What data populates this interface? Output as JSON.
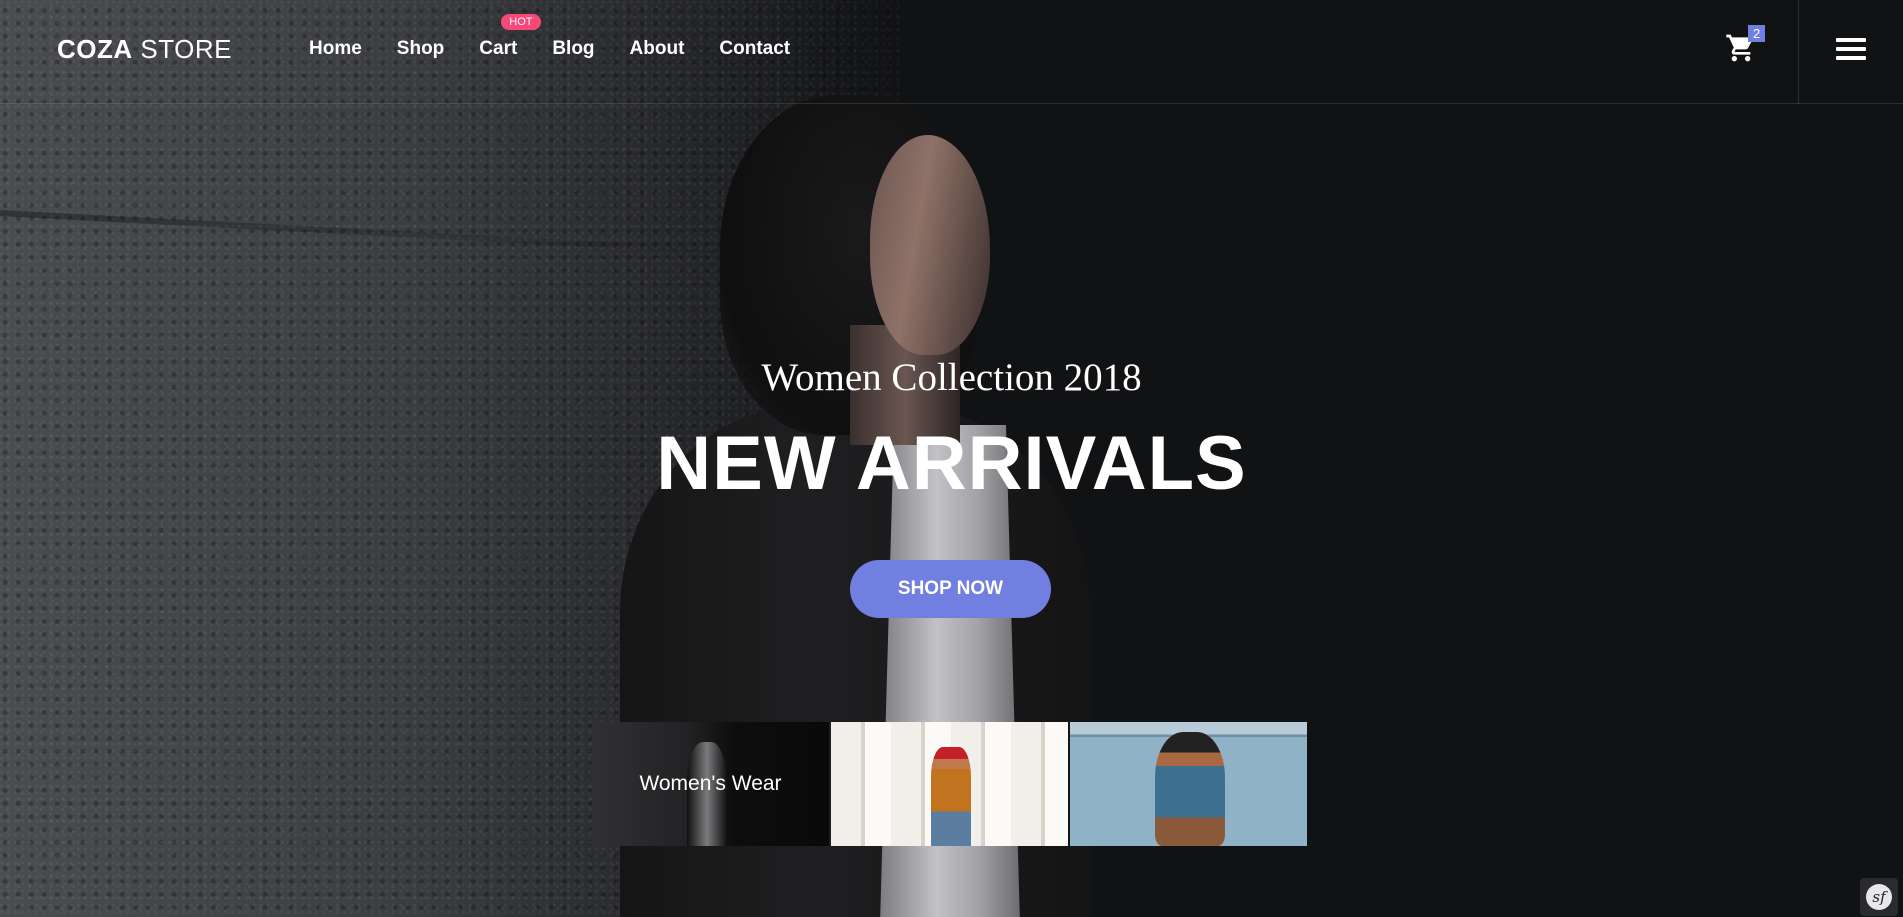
{
  "header": {
    "logo_bold": "COZA",
    "logo_light": " STORE",
    "nav": [
      {
        "label": "Home"
      },
      {
        "label": "Shop"
      },
      {
        "label": "Cart",
        "badge": "HOT"
      },
      {
        "label": "Blog"
      },
      {
        "label": "About"
      },
      {
        "label": "Contact"
      }
    ],
    "cart_count": "2",
    "cart_icon": "cart-icon",
    "menu_icon": "hamburger-menu-icon"
  },
  "hero": {
    "subtitle": "Women Collection 2018",
    "title": "NEW ARRIVALS",
    "button_label": "SHOP NOW"
  },
  "thumbnails": [
    {
      "label": "Women's Wear",
      "active": true
    },
    {
      "label": "",
      "active": false
    },
    {
      "label": "",
      "active": false
    }
  ],
  "colors": {
    "accent": "#717fe0",
    "hot_badge": "#f74877",
    "background": "#111214"
  },
  "corner_icon": "symfony-icon"
}
